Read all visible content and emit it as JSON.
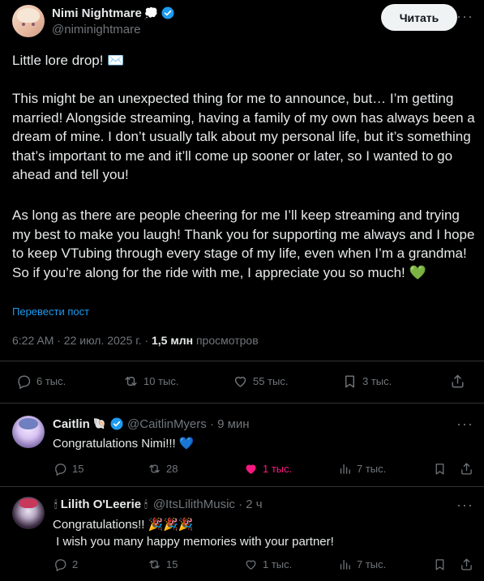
{
  "tweet": {
    "author_name": "Nimi Nightmare",
    "author_emoji": "💭",
    "author_handle": "@niminightmare",
    "follow_label": "Читать",
    "line1": "Little lore drop! ✉️",
    "paragraph2": "This might be an unexpected thing for me to announce, but… I’m getting married! Alongside streaming, having a family of my own has always been a dream of mine. I don’t usually talk about my personal life, but it’s something that’s important to me and it’ll come up sooner or later, so I wanted to go ahead and tell you!",
    "paragraph3": "As long as there are people cheering for me I’ll keep streaming and trying my best to make you laugh! Thank you for supporting me always and I hope to keep VTubing through every stage of my life, even when I’m a grandma! So if you’re along for the ride with me, I appreciate you so much! 💚",
    "translate_label": "Перевести пост",
    "timestamp": "6:22 AM · 22 июл. 2025 г. · ",
    "views_count": "1,5 млн",
    "views_label": " просмотров",
    "stats": {
      "replies": "6 тыс.",
      "reposts": "10 тыс.",
      "likes": "55 тыс.",
      "bookmarks": "3 тыс."
    }
  },
  "replies": [
    {
      "author_name": "Caitlin",
      "author_emoji": "🐚",
      "author_handle": "@CaitlinMyers · 9 мин",
      "text": "Congratulations Nimi!!! 💙",
      "replies": "15",
      "reposts": "28",
      "likes": "1 тыс.",
      "views": "7 тыс."
    },
    {
      "author_name": "Lilith O'Leerie",
      "author_emoji_pre": "🕯",
      "author_emoji_post": "🕯",
      "author_handle": "@ItsLilithMusic · 2 ч",
      "text": "Congratulations!! 🎉🎉🎉\n I wish you many happy memories with your partner!",
      "replies": "2",
      "reposts": "15",
      "likes": "1 тыс.",
      "views": "7 тыс."
    }
  ],
  "colors": {
    "accent": "#1d9bf0",
    "liked": "#f91880",
    "muted": "#71767b"
  }
}
